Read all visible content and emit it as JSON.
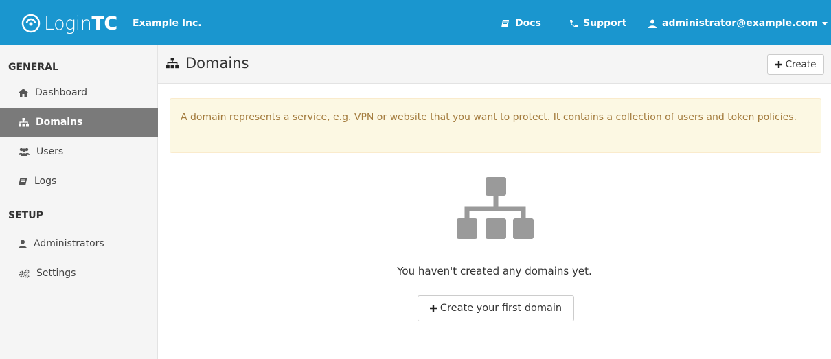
{
  "app": {
    "logo_prefix": "Login",
    "logo_suffix": "TC",
    "company": "Example Inc."
  },
  "topnav": {
    "docs": "Docs",
    "support": "Support",
    "user": "administrator@example.com"
  },
  "sidebar": {
    "sections": [
      {
        "heading": "GENERAL"
      },
      {
        "heading": "SETUP"
      }
    ],
    "items": [
      {
        "label": "Dashboard",
        "icon": "home-icon"
      },
      {
        "label": "Domains",
        "icon": "sitemap-icon",
        "active": true
      },
      {
        "label": "Users",
        "icon": "users-icon"
      },
      {
        "label": "Logs",
        "icon": "book-icon"
      },
      {
        "label": "Administrators",
        "icon": "user-icon"
      },
      {
        "label": "Settings",
        "icon": "cogs-icon"
      }
    ]
  },
  "header": {
    "title": "Domains",
    "create_label": "Create"
  },
  "main": {
    "alert": "A domain represents a service, e.g. VPN or website that you want to protect. It contains a collection of users and token policies.",
    "empty_text": "You haven't created any domains yet.",
    "create_first_label": "Create your first domain"
  },
  "colors": {
    "topbar": "#1a96cf",
    "sidebar_active": "#7a7a7a",
    "alert_bg": "#fcf8e3",
    "alert_text": "#a37b3d"
  }
}
